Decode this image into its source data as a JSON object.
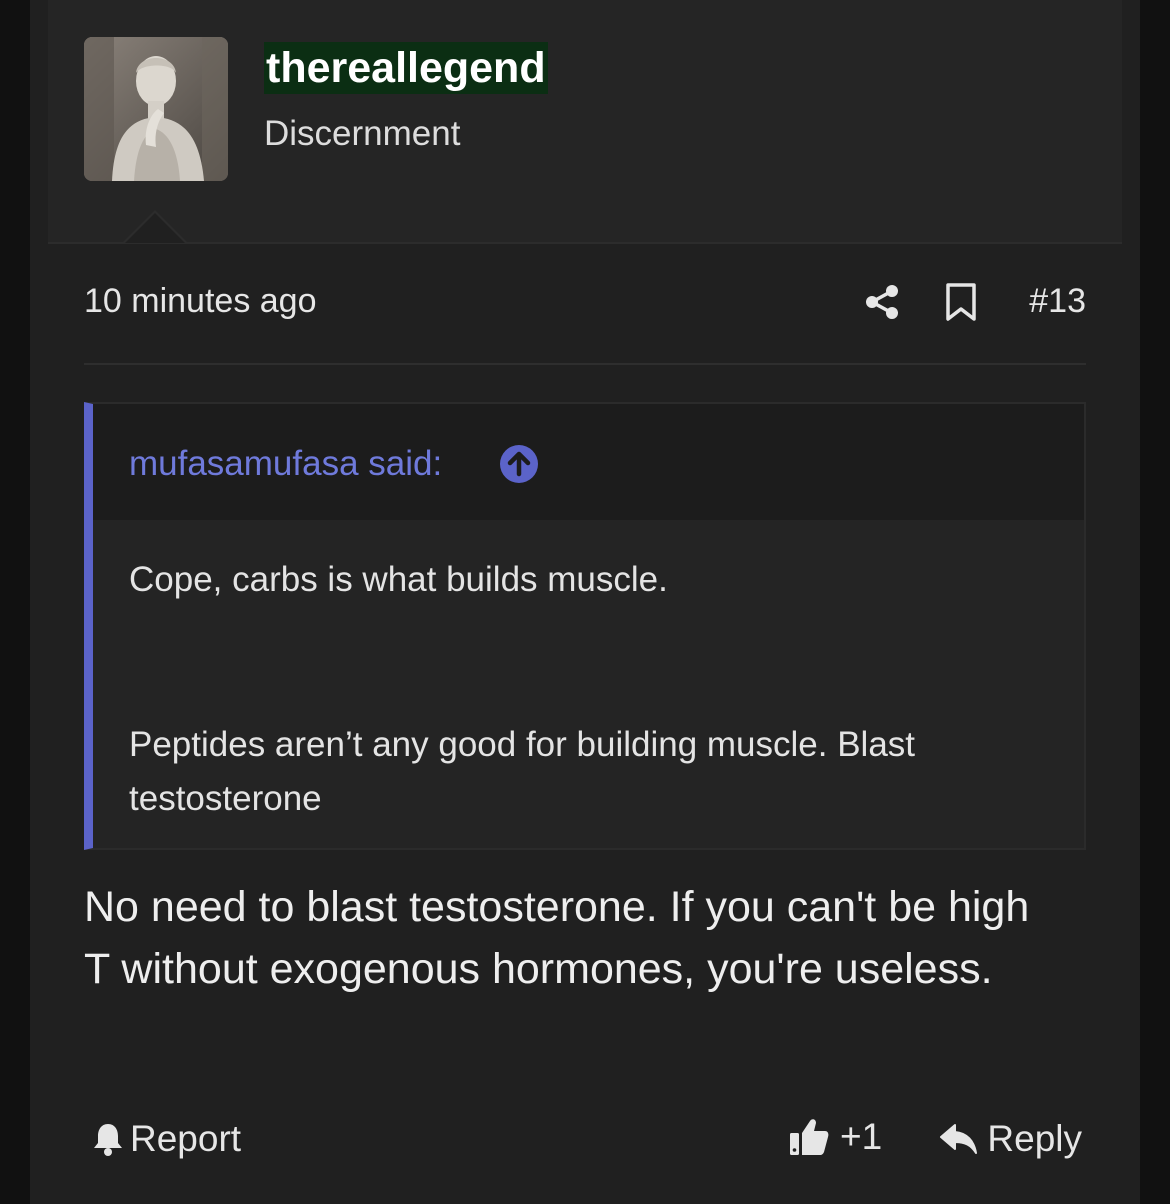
{
  "author": {
    "username": "thereallegend",
    "title": "Discernment",
    "avatar_icon": "statue-avatar"
  },
  "meta": {
    "timestamp": "10 minutes ago",
    "post_number": "#13"
  },
  "quote": {
    "author_line": "mufasamufasa said:",
    "paragraphs": [
      "Cope, carbs is what builds muscle.",
      "Peptides aren’t any good for building muscle. Blast testosterone"
    ]
  },
  "body": "No need to blast testosterone. If you can't be high T without exogenous hormones, you're useless.",
  "footer": {
    "report_label": "Report",
    "reaction_count": "+1",
    "reply_label": "Reply"
  },
  "colors": {
    "background": "#202020",
    "quote_accent": "#5b63c9",
    "quote_author": "#6f7adb",
    "username_highlight": "#0b2e13"
  }
}
